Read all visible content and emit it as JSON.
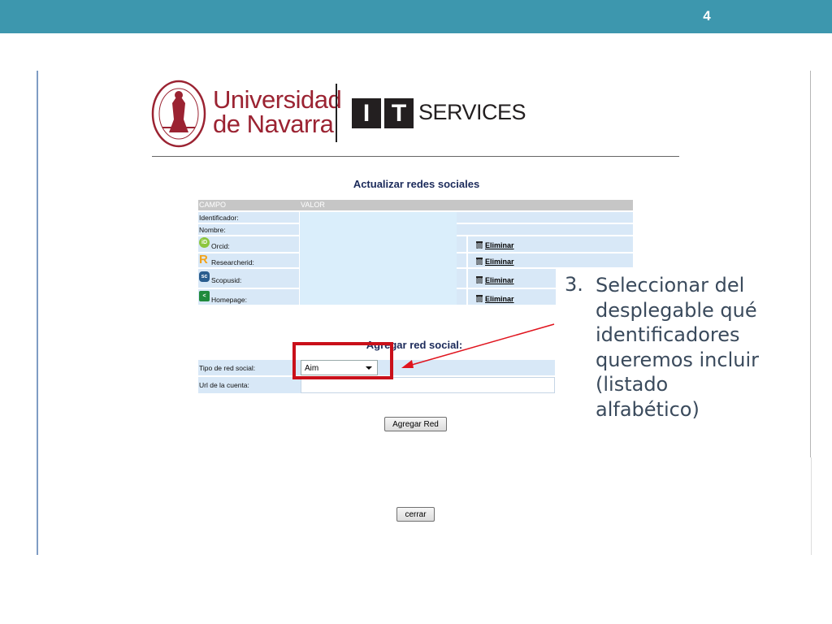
{
  "slide": {
    "number": "4"
  },
  "header": {
    "university_name_line1": "Universidad",
    "university_name_line2": "de Navarra",
    "it_letter_1": "I",
    "it_letter_2": "T",
    "services": "SERVICES"
  },
  "form": {
    "title": "Actualizar redes sociales",
    "table": {
      "col_campo": "CAMPO",
      "col_valor": "VALOR",
      "rows": [
        {
          "label": "Identificador:",
          "icon": ""
        },
        {
          "label": "Nombre:",
          "icon": ""
        },
        {
          "label": "Orcid:",
          "icon": "orcid-icon",
          "action": "Eliminar"
        },
        {
          "label": "Researcherid:",
          "icon": "researcherid-icon",
          "action": "Eliminar"
        },
        {
          "label": "Scopusid:",
          "icon": "scopus-icon",
          "action": "Eliminar"
        },
        {
          "label": "Homepage:",
          "icon": "share-icon",
          "action": "Eliminar"
        }
      ]
    },
    "add": {
      "title": "Agregar red social:",
      "tipo_label": "Tipo de red social:",
      "tipo_value": "Aim",
      "url_label": "Url de la cuenta:",
      "url_value": "",
      "submit": "Agregar Red"
    },
    "close": "cerrar"
  },
  "callout": {
    "number": "3.",
    "text": "Seleccionar del\ndesplegable qué\nidentificadores\nqueremos incluir\n(listado\nalfabético)"
  },
  "colors": {
    "topbar": "#3d97ae",
    "brand_red": "#9b2332",
    "highlight": "#c9101a",
    "cell_blue": "#d8e8f7"
  }
}
